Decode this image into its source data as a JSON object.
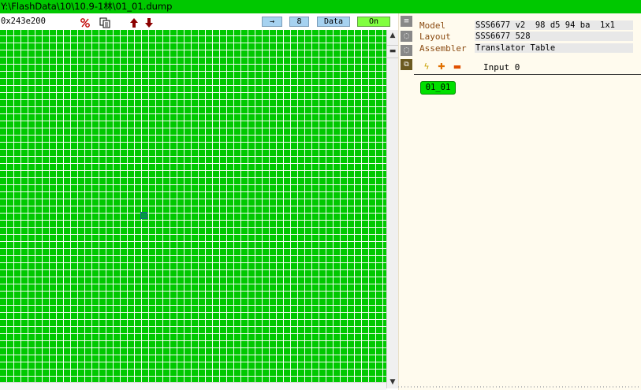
{
  "title": "Y:\\FlashData\\10\\10.9-1林\\01_01.dump",
  "toolbar": {
    "address_value": "0x243e200",
    "icons": [
      "percent-icon",
      "copy-icon",
      "arrow-up-icon",
      "arrow-down-icon"
    ],
    "arrow_button": "→",
    "width_button": "8",
    "mode_button": "Data",
    "toggle_button": "On"
  },
  "panel": {
    "properties": [
      {
        "label": "Model",
        "value": "SSS6677 v2  98 d5 94 ba  1x1"
      },
      {
        "label": "Layout",
        "value": "SSS6677 528"
      },
      {
        "label": "Assembler",
        "value": "Translator Table"
      }
    ],
    "input_label": "Input 0",
    "chip_label": "01_01"
  },
  "colors": {
    "grid_green": "#00c800",
    "title_green": "#00c800",
    "panel_bg": "#fffbee",
    "label_brown": "#8a4a10",
    "button_blue": "#a6d2f0",
    "toggle_green": "#80ff40"
  }
}
